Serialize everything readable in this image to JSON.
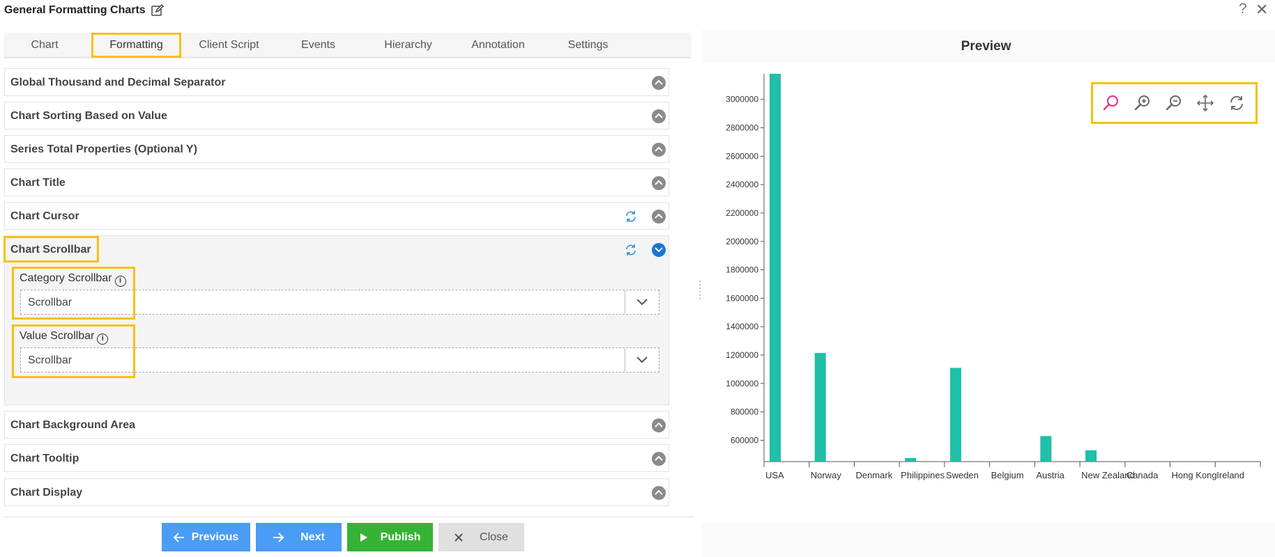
{
  "window": {
    "title": "General Formatting Charts",
    "help_label": "?",
    "close_label": "✕"
  },
  "tabs": [
    {
      "label": "Chart"
    },
    {
      "label": "Formatting"
    },
    {
      "label": "Client Script"
    },
    {
      "label": "Events"
    },
    {
      "label": "Hierarchy"
    },
    {
      "label": "Annotation"
    },
    {
      "label": "Settings"
    }
  ],
  "sections": [
    {
      "label": "Global Thousand and Decimal Separator"
    },
    {
      "label": "Chart Sorting Based on Value"
    },
    {
      "label": "Series Total Properties (Optional Y)"
    },
    {
      "label": "Chart Title"
    },
    {
      "label": "Chart Cursor"
    },
    {
      "label": "Chart Scrollbar"
    },
    {
      "label": "Chart Background Area"
    },
    {
      "label": "Chart Tooltip"
    },
    {
      "label": "Chart Display"
    }
  ],
  "scrollbar_section": {
    "category_label": "Category Scrollbar",
    "category_value": "Scrollbar",
    "value_label": "Value Scrollbar",
    "value_value": "Scrollbar",
    "info_glyph": "i"
  },
  "buttons": {
    "previous": "Previous",
    "next": "Next",
    "publish": "Publish",
    "close": "Close"
  },
  "preview": {
    "title": "Preview"
  },
  "colors": {
    "highlight": "#f6c013",
    "bar": "#1fbfa8",
    "primary_button": "#4a9cf5",
    "publish_button": "#36b336",
    "active_chevron": "#1877d1"
  },
  "chart_data": {
    "type": "bar",
    "categories": [
      "USA",
      "Norway",
      "Denmark",
      "Philippines",
      "Sweden",
      "Belgium",
      "Austria",
      "New Zealand",
      "Canada",
      "Hong Kong",
      "Ireland"
    ],
    "values": [
      3180000,
      1215000,
      0,
      475000,
      1110000,
      0,
      630000,
      530000,
      0,
      0,
      0
    ],
    "y_ticks": [
      "600000",
      "800000",
      "1000000",
      "1200000",
      "1400000",
      "1600000",
      "1800000",
      "2000000",
      "2200000",
      "2400000",
      "2600000",
      "2800000",
      "3000000"
    ],
    "ylim": [
      450000,
      3180000
    ],
    "grid": false,
    "legend": "none"
  }
}
